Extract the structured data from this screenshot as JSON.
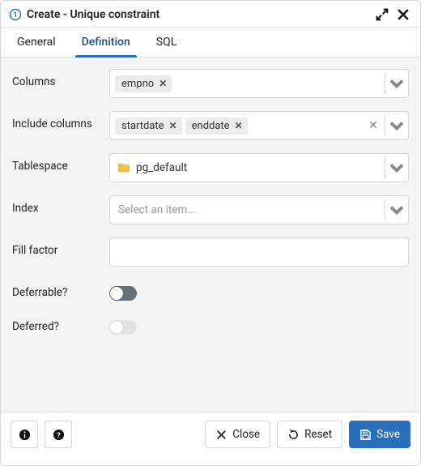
{
  "titlebar": {
    "title": "Create - Unique constraint"
  },
  "tabs": {
    "items": [
      {
        "label": "General",
        "active": false
      },
      {
        "label": "Definition",
        "active": true
      },
      {
        "label": "SQL",
        "active": false
      }
    ]
  },
  "fields": {
    "columns": {
      "label": "Columns",
      "chips": [
        "empno"
      ]
    },
    "include_columns": {
      "label": "Include columns",
      "chips": [
        "startdate",
        "enddate"
      ],
      "show_clear": true
    },
    "tablespace": {
      "label": "Tablespace",
      "value": "pg_default"
    },
    "index": {
      "label": "Index",
      "placeholder": "Select an item..."
    },
    "fill_factor": {
      "label": "Fill factor",
      "value": ""
    },
    "deferrable": {
      "label": "Deferrable?",
      "enabled": true,
      "on": false
    },
    "deferred": {
      "label": "Deferred?",
      "enabled": false,
      "on": false
    }
  },
  "footer": {
    "close": "Close",
    "reset": "Reset",
    "save": "Save"
  }
}
